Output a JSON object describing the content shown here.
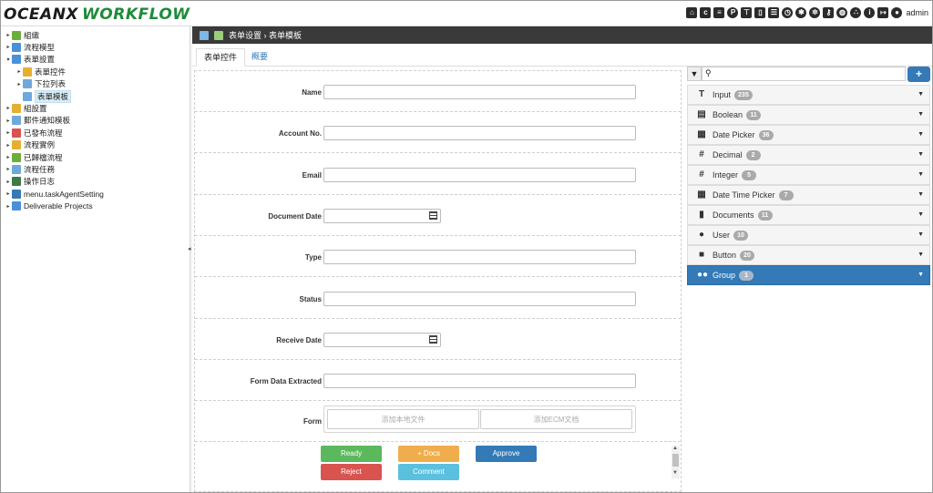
{
  "app": {
    "logo_part1": "OCEANX",
    "logo_part2": "WORKFLOW",
    "user": "admin"
  },
  "toolbar": {
    "icons": [
      "home-icon",
      "ch-icon",
      "checklist-icon",
      "p-icon",
      "sitemap-icon",
      "trash-icon",
      "list-icon",
      "clock-icon",
      "gear-icon",
      "gears-icon",
      "key-icon",
      "globe-icon",
      "network-icon",
      "info-icon",
      "logout-icon",
      "user-icon"
    ]
  },
  "tree": {
    "items": [
      {
        "label": "組織",
        "indent": 0,
        "caret": "▸",
        "color": "#6cae3a"
      },
      {
        "label": "流程模型",
        "indent": 0,
        "caret": "▸",
        "color": "#4a90d9"
      },
      {
        "label": "表單設置",
        "indent": 0,
        "caret": "▾",
        "color": "#4a90d9"
      },
      {
        "label": "表單控件",
        "indent": 1,
        "caret": "▸",
        "color": "#e5b032"
      },
      {
        "label": "下拉列表",
        "indent": 1,
        "caret": "▸",
        "color": "#6fa8dc"
      },
      {
        "label": "表單模板",
        "indent": 1,
        "caret": "",
        "color": "#6fa8dc",
        "selected": true
      },
      {
        "label": "組設置",
        "indent": 0,
        "caret": "▸",
        "color": "#e5b032"
      },
      {
        "label": "郵件通知模板",
        "indent": 0,
        "caret": "▸",
        "color": "#6fa8dc"
      },
      {
        "label": "已發布流程",
        "indent": 0,
        "caret": "▸",
        "color": "#d9534f"
      },
      {
        "label": "流程實例",
        "indent": 0,
        "caret": "▸",
        "color": "#e5b032"
      },
      {
        "label": "已歸檔流程",
        "indent": 0,
        "caret": "▸",
        "color": "#6cae3a"
      },
      {
        "label": "流程任務",
        "indent": 0,
        "caret": "▸",
        "color": "#6fa8dc"
      },
      {
        "label": "操作日志",
        "indent": 0,
        "caret": "▸",
        "color": "#3c7a4a"
      },
      {
        "label": "menu.taskAgentSetting",
        "indent": 0,
        "caret": "▸",
        "color": "#337ab7"
      },
      {
        "label": "Deliverable Projects",
        "indent": 0,
        "caret": "▸",
        "color": "#4a90d9"
      }
    ]
  },
  "breadcrumb": {
    "text": "表单设置 › 表单模板"
  },
  "tabs": [
    {
      "label": "表单控件",
      "active": true
    },
    {
      "label": "概要",
      "active": false
    }
  ],
  "form": {
    "fields": [
      {
        "label": "Name",
        "type": "text"
      },
      {
        "label": "Account No.",
        "type": "text"
      },
      {
        "label": "Email",
        "type": "text"
      },
      {
        "label": "Document Date",
        "type": "date"
      },
      {
        "label": "Type",
        "type": "text"
      },
      {
        "label": "Status",
        "type": "text"
      },
      {
        "label": "Receive Date",
        "type": "date"
      },
      {
        "label": "Form Data Extracted",
        "type": "text"
      },
      {
        "label": "Form",
        "type": "upload"
      }
    ],
    "upload": {
      "local": "添加本地文件",
      "ecm": "添加ECM文档"
    },
    "actions": [
      {
        "label": "Ready",
        "color": "#5cb85c"
      },
      {
        "label": "+ Docs",
        "color": "#f0ad4e"
      },
      {
        "label": "Approve",
        "color": "#337ab7"
      },
      {
        "label": "Reject",
        "color": "#d9534f"
      },
      {
        "label": "Comment",
        "color": "#5bc0de"
      }
    ]
  },
  "palette": {
    "search_placeholder": "",
    "add_label": "+",
    "items": [
      {
        "label": "Input",
        "count": "235",
        "icon": "T"
      },
      {
        "label": "Boolean",
        "count": "11",
        "icon": "▤"
      },
      {
        "label": "Date Picker",
        "count": "36",
        "icon": "▦"
      },
      {
        "label": "Decimal",
        "count": "2",
        "icon": "#"
      },
      {
        "label": "Integer",
        "count": "5",
        "icon": "#"
      },
      {
        "label": "Date Time Picker",
        "count": "7",
        "icon": "▦"
      },
      {
        "label": "Documents",
        "count": "11",
        "icon": "▮"
      },
      {
        "label": "User",
        "count": "10",
        "icon": "●"
      },
      {
        "label": "Button",
        "count": "20",
        "icon": "■"
      },
      {
        "label": "Group",
        "count": "1",
        "icon": "●●",
        "active": true
      }
    ]
  }
}
